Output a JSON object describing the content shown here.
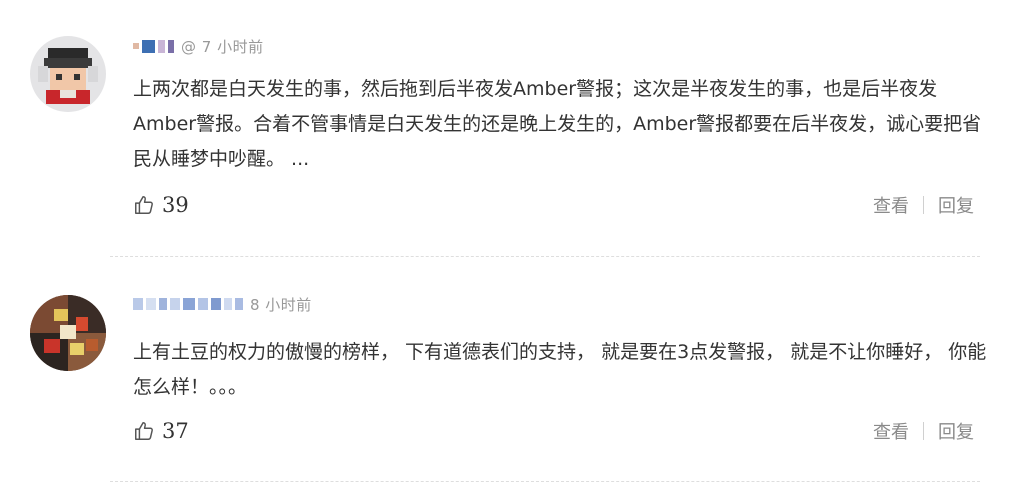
{
  "comments": [
    {
      "timestamp": "@ 7 小时前",
      "text": "上两次都是白天发生的事，然后拖到后半夜发Amber警报；这次是半夜发生的事，也是后半夜发Amber警报。合着不管事情是白天发生的还是晚上发生的，Amber警报都要在后半夜发，诚心要把省民从睡梦中吵醒。 ...",
      "likes": "39",
      "view_label": "查看",
      "reply_label": "回复"
    },
    {
      "timestamp": "8 小时前",
      "text": "上有土豆的权力的傲慢的榜样， 下有道德表们的支持， 就是要在3点发警报， 就是不让你睡好， 你能怎么样！。。。",
      "likes": "37",
      "view_label": "查看",
      "reply_label": "回复"
    }
  ],
  "colors": {
    "meta_text": "#999999",
    "body_text": "#333333",
    "action_text": "#8a8a8a"
  },
  "icons": {
    "like": "thumbs-up-icon",
    "avatar": "pixelated-avatar"
  }
}
